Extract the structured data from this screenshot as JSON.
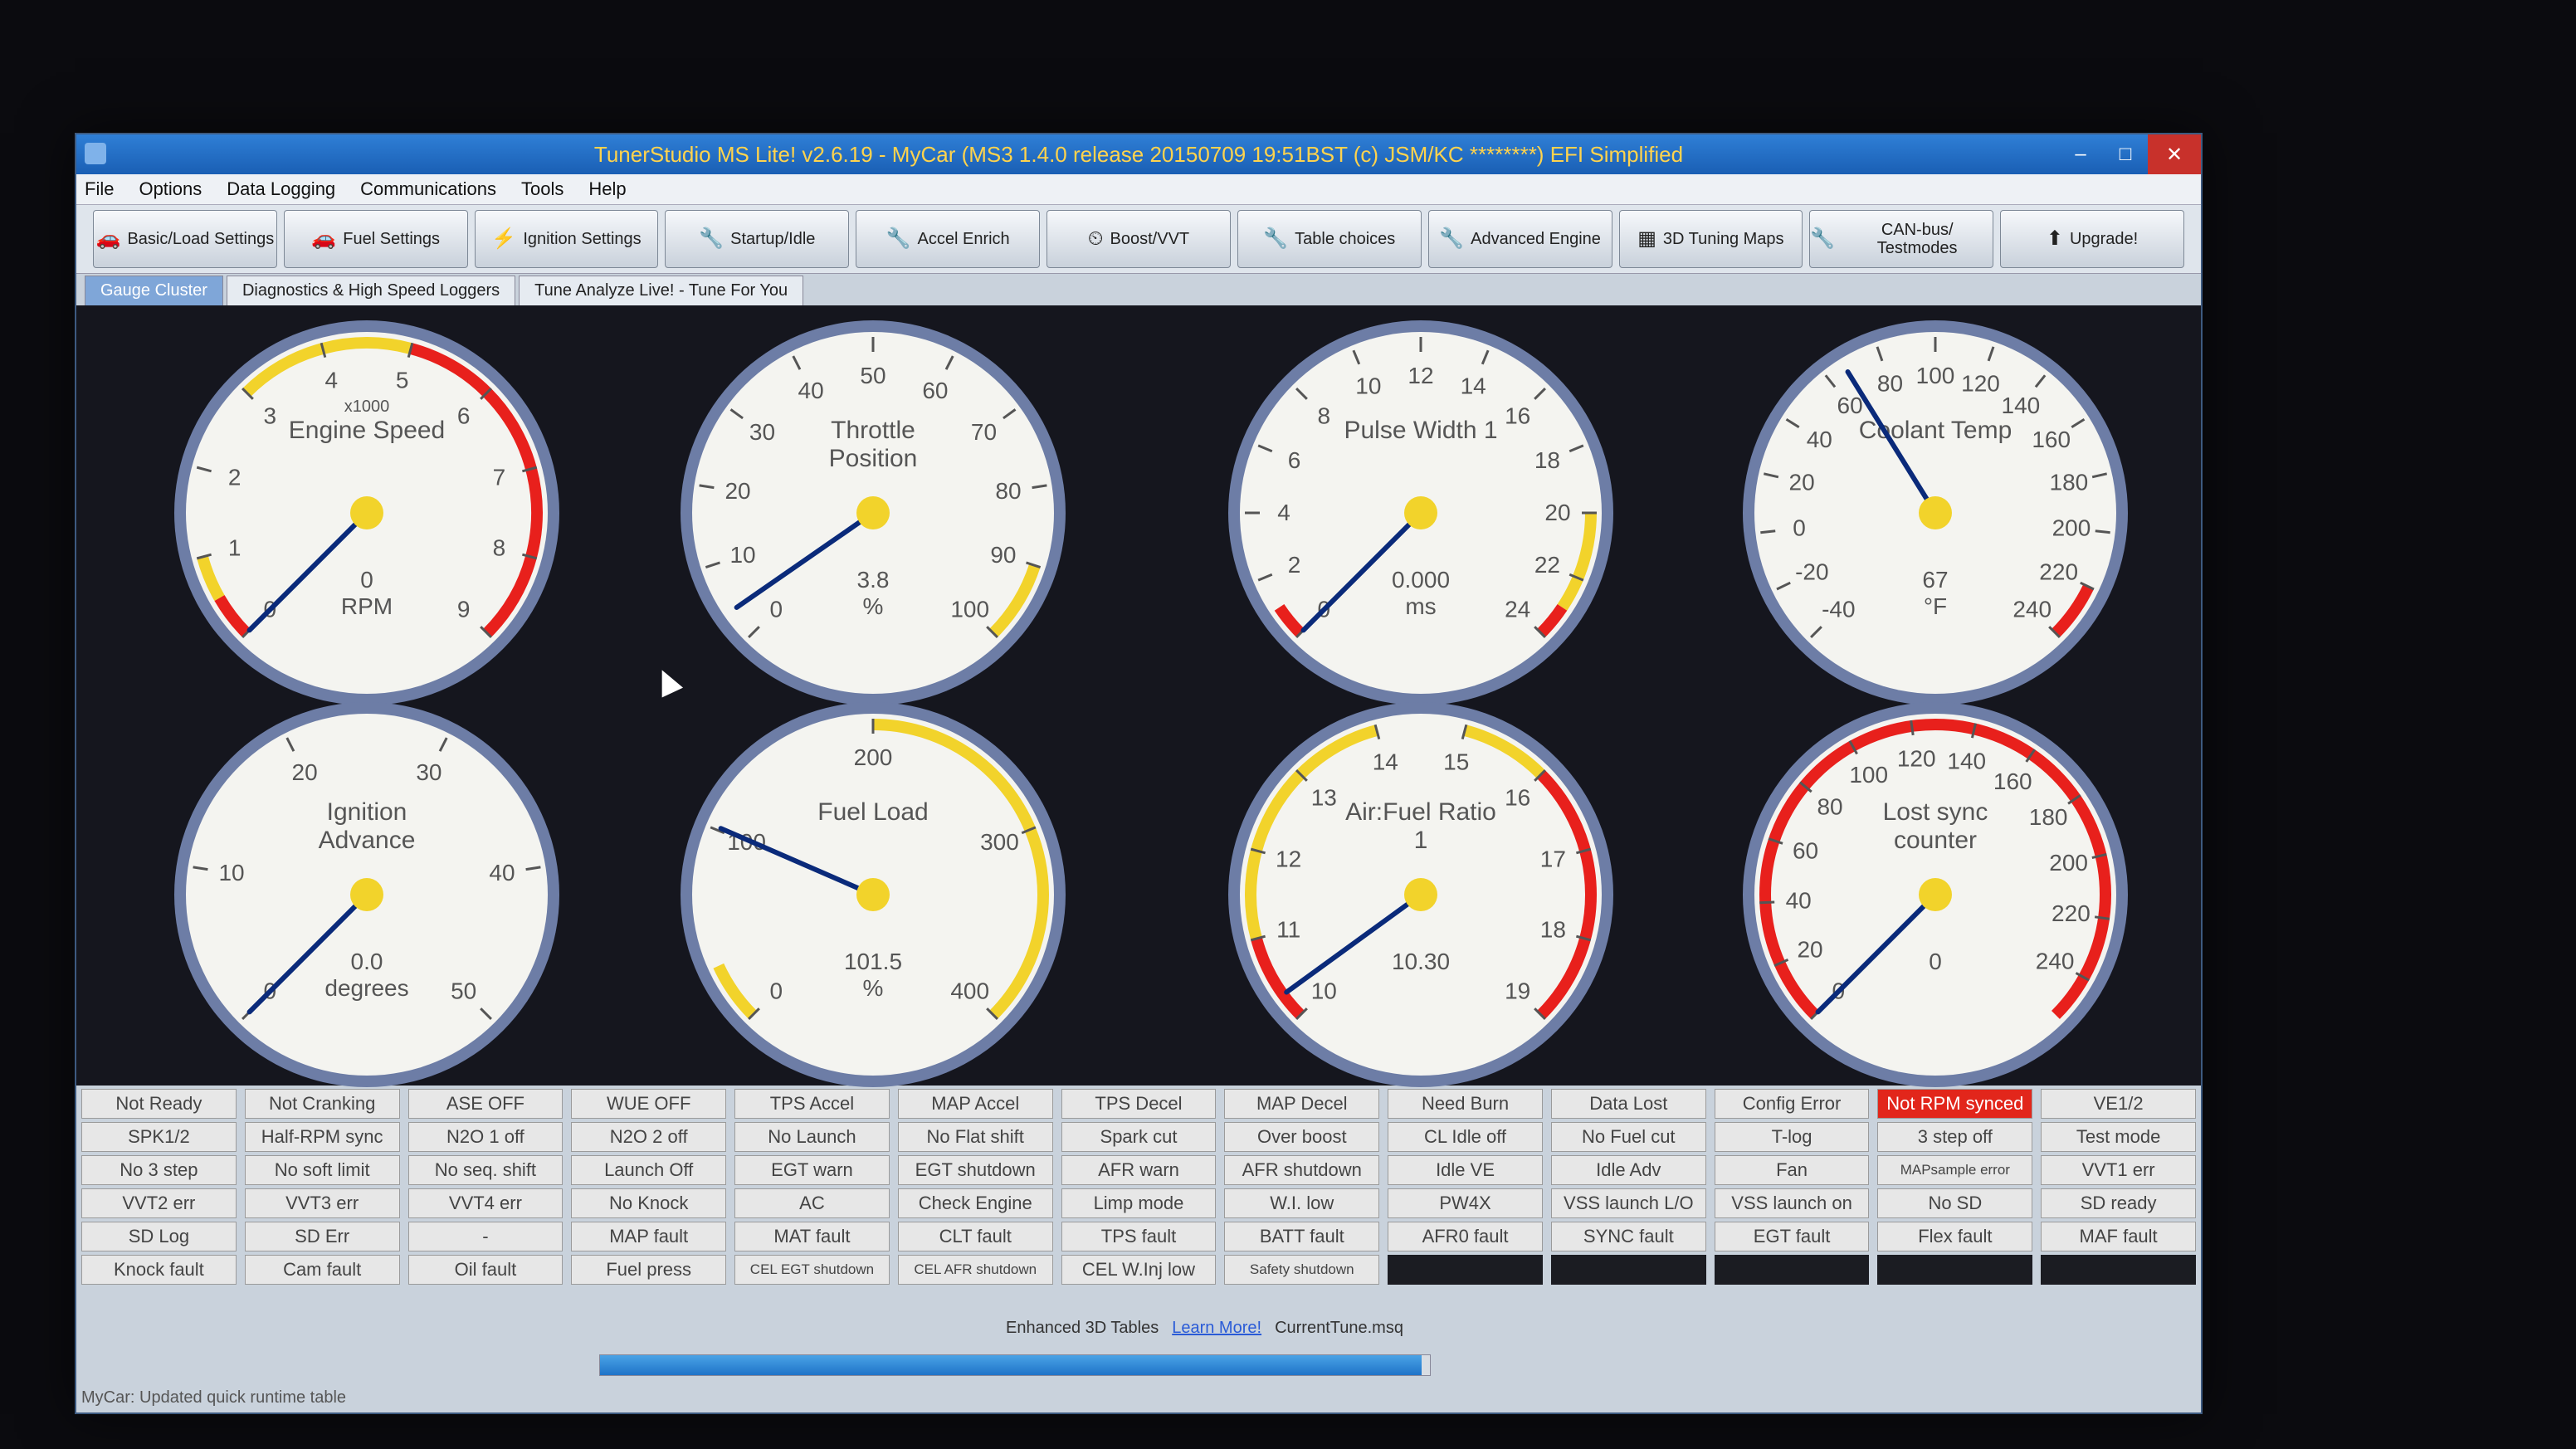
{
  "window": {
    "title": "TunerStudio MS Lite! v2.6.19 - MyCar (MS3 1.4.0 release    20150709 19:51BST (c) JSM/KC ********) EFI Simplified"
  },
  "menu": [
    "File",
    "Options",
    "Data Logging",
    "Communications",
    "Tools",
    "Help"
  ],
  "toolbar": [
    {
      "label": "Basic/Load Settings",
      "icon": "car-icon"
    },
    {
      "label": "Fuel Settings",
      "icon": "car-icon"
    },
    {
      "label": "Ignition Settings",
      "icon": "spark-icon"
    },
    {
      "label": "Startup/Idle",
      "icon": "wrench-icon"
    },
    {
      "label": "Accel Enrich",
      "icon": "wrench-icon"
    },
    {
      "label": "Boost/VVT",
      "icon": "gauge-icon"
    },
    {
      "label": "Table choices",
      "icon": "wrench-icon"
    },
    {
      "label": "Advanced Engine",
      "icon": "wrench-icon"
    },
    {
      "label": "3D Tuning Maps",
      "icon": "chart-icon"
    },
    {
      "label": "CAN-bus/ Testmodes",
      "icon": "wrench-icon"
    },
    {
      "label": "Upgrade!",
      "icon": "upgrade-icon"
    }
  ],
  "tabs": [
    "Gauge Cluster",
    "Diagnostics & High Speed Loggers",
    "Tune Analyze Live! - Tune For You"
  ],
  "gauges": [
    {
      "title": "Engine Speed",
      "scale_label": "x1000",
      "value_text": "0",
      "unit": "RPM",
      "min": 0,
      "max": 9,
      "value": 0,
      "ticks": [
        0,
        1,
        2,
        3,
        4,
        5,
        6,
        7,
        8,
        9
      ],
      "zones": [
        {
          "from": 0,
          "to": 0.5,
          "color": "#e8201c"
        },
        {
          "from": 0.5,
          "to": 1,
          "color": "#f2d32b"
        },
        {
          "from": 3,
          "to": 5,
          "color": "#f2d32b"
        },
        {
          "from": 5,
          "to": 9,
          "color": "#e8201c"
        }
      ]
    },
    {
      "title": "Throttle Position",
      "scale_label": "",
      "value_text": "3.8",
      "unit": "%",
      "min": 0,
      "max": 100,
      "value": 3.8,
      "ticks": [
        0,
        10,
        20,
        30,
        40,
        50,
        60,
        70,
        80,
        90,
        100
      ],
      "zones": [
        {
          "from": 90,
          "to": 100,
          "color": "#f2d32b"
        }
      ]
    },
    {
      "title": "Pulse Width 1",
      "scale_label": "",
      "value_text": "0.000",
      "unit": "ms",
      "min": 0,
      "max": 24,
      "value": 0,
      "ticks": [
        0,
        2,
        4,
        6,
        8,
        10,
        12,
        14,
        16,
        18,
        20,
        22,
        24
      ],
      "zones": [
        {
          "from": 0,
          "to": 1,
          "color": "#e8201c"
        },
        {
          "from": 20,
          "to": 23,
          "color": "#f2d32b"
        },
        {
          "from": 23,
          "to": 24,
          "color": "#e8201c"
        }
      ]
    },
    {
      "title": "Coolant Temp",
      "scale_label": "",
      "value_text": "67",
      "unit": "°F",
      "min": -40,
      "max": 240,
      "value": 67,
      "ticks": [
        -40,
        -20,
        0,
        20,
        40,
        60,
        80,
        100,
        120,
        140,
        160,
        180,
        200,
        220,
        240
      ],
      "zones": [
        {
          "from": 220,
          "to": 240,
          "color": "#e8201c"
        }
      ]
    },
    {
      "title": "Ignition Advance",
      "scale_label": "",
      "value_text": "0.0",
      "unit": "degrees",
      "min": 0,
      "max": 50,
      "value": 0,
      "ticks": [
        0,
        10,
        20,
        30,
        40,
        50
      ],
      "zones": []
    },
    {
      "title": "Fuel Load",
      "scale_label": "",
      "value_text": "101.5",
      "unit": "%",
      "min": 0,
      "max": 400,
      "value": 101.5,
      "ticks": [
        0,
        100,
        200,
        300,
        400
      ],
      "zones": [
        {
          "from": 0,
          "to": 30,
          "color": "#f2d32b"
        },
        {
          "from": 200,
          "to": 400,
          "color": "#f2d32b"
        }
      ]
    },
    {
      "title": "Air:Fuel Ratio 1",
      "scale_label": "",
      "value_text": "10.30",
      "unit": "",
      "min": 10,
      "max": 19,
      "value": 10.3,
      "ticks": [
        10,
        11,
        12,
        13,
        14,
        15,
        16,
        17,
        18,
        19
      ],
      "zones": [
        {
          "from": 10,
          "to": 11,
          "color": "#e8201c"
        },
        {
          "from": 11,
          "to": 14,
          "color": "#f2d32b"
        },
        {
          "from": 15,
          "to": 16,
          "color": "#f2d32b"
        },
        {
          "from": 16,
          "to": 19,
          "color": "#e8201c"
        }
      ]
    },
    {
      "title": "Lost sync counter",
      "scale_label": "",
      "value_text": "0",
      "unit": "",
      "min": 0,
      "max": 255,
      "value": 0,
      "ticks": [
        0,
        20,
        40,
        60,
        80,
        100,
        120,
        140,
        160,
        180,
        200,
        220,
        240
      ],
      "zones": [
        {
          "from": 0,
          "to": 255,
          "color": "#e8201c"
        }
      ]
    }
  ],
  "indicators": [
    [
      "Not Ready",
      "SPK1/2",
      "No 3 step",
      "VVT2 err",
      "SD Log",
      "Knock fault"
    ],
    [
      "Not Cranking",
      "Half-RPM sync",
      "No soft limit",
      "VVT3 err",
      "SD Err",
      "Cam fault"
    ],
    [
      "ASE OFF",
      "N2O 1 off",
      "No seq. shift",
      "VVT4 err",
      "-",
      "Oil fault"
    ],
    [
      "WUE OFF",
      "N2O 2 off",
      "Launch Off",
      "No Knock",
      "MAP fault",
      "Fuel press"
    ],
    [
      "TPS Accel",
      "No Launch",
      "EGT warn",
      "AC",
      "MAT fault",
      "CEL EGT shutdown"
    ],
    [
      "MAP Accel",
      "No Flat shift",
      "EGT shutdown",
      "Check Engine",
      "CLT fault",
      "CEL AFR shutdown"
    ],
    [
      "TPS Decel",
      "Spark cut",
      "AFR warn",
      "Limp mode",
      "TPS fault",
      "CEL W.Inj low"
    ],
    [
      "MAP Decel",
      "Over boost",
      "AFR shutdown",
      "W.I. low",
      "BATT fault",
      "Safety shutdown"
    ],
    [
      "Need Burn",
      "CL Idle off",
      "Idle VE",
      "PW4X",
      "AFR0 fault",
      ""
    ],
    [
      "Data Lost",
      "No Fuel cut",
      "Idle Adv",
      "VSS launch L/O",
      "SYNC fault",
      ""
    ],
    [
      "Config Error",
      "T-log",
      "Fan",
      "VSS launch on",
      "EGT fault",
      ""
    ],
    [
      "Not RPM synced",
      "3 step off",
      "MAPsample error",
      "No SD",
      "Flex fault",
      ""
    ],
    [
      "VE1/2",
      "Test mode",
      "VVT1 err",
      "SD ready",
      "MAF fault",
      ""
    ]
  ],
  "footer": {
    "enhanced": "Enhanced 3D Tables",
    "learn_more": "Learn More!",
    "file": "CurrentTune.msq",
    "status": "MyCar: Updated quick runtime table",
    "progress": 0.99
  },
  "colors": {
    "red": "#e8201c",
    "yellow": "#f2d32b",
    "needle": "#0a2a7a"
  }
}
